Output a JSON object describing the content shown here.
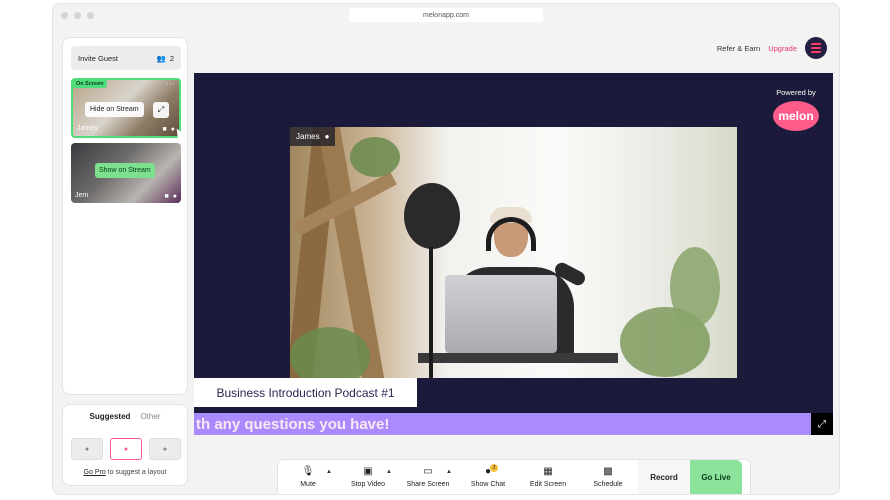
{
  "window": {
    "url": "melonapp.com"
  },
  "topbar": {
    "refer_label": "Refer & Earn",
    "upgrade_label": "Upgrade",
    "logo_icon": "melon-logo-icon",
    "upgrade_color": "#e8386b"
  },
  "guests": {
    "invite_label": "Invite Guest",
    "guest_count": "2",
    "items": [
      {
        "name": "James",
        "status_badge": "On Screen",
        "action_label": "Hide on Stream",
        "more_glyph": "···"
      },
      {
        "name": "Jem",
        "action_label": "Show on Stream"
      }
    ]
  },
  "layouts": {
    "tabs": [
      "Suggested",
      "Other"
    ],
    "go_pro_link": "Go Pro",
    "go_pro_suffix": " to suggest a layout"
  },
  "stage": {
    "powered_by": "Powered by",
    "brand": "melon",
    "speaker_name": "James",
    "title": "Business Introduction Podcast #1",
    "ticker_text": "th any questions you have!",
    "background_color": "#1c1a3a",
    "ticker_color": "#a98bff"
  },
  "toolbar": {
    "mute": "Mute",
    "stop_video": "Stop Video",
    "share_screen": "Share Screen",
    "show_chat": "Show Chat",
    "chat_badge": "3",
    "edit_screen": "Edit Screen",
    "schedule": "Schedule",
    "record": "Record",
    "go_live": "Go Live",
    "go_live_color": "#8be39b"
  }
}
